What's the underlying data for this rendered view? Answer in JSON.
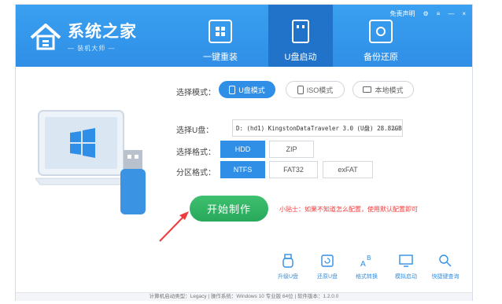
{
  "header": {
    "logo_title": "系统之家",
    "logo_sub": "— 装机大师 —",
    "nav": [
      {
        "label": "一键重装"
      },
      {
        "label": "U盘启动"
      },
      {
        "label": "备份还原"
      }
    ],
    "top_right": {
      "disclaimer": "免责声明",
      "minimize": "—",
      "close": "×"
    }
  },
  "main": {
    "mode_label": "选择模式：",
    "modes": [
      {
        "label": "U盘模式",
        "selected": true
      },
      {
        "label": "ISO模式",
        "selected": false
      },
      {
        "label": "本地模式",
        "selected": false
      }
    ],
    "usb_label": "选择U盘：",
    "usb_value": "D: (hd1) KingstonDataTraveler 3.0 (U盘) 28.82GB",
    "format_label": "选择格式：",
    "formats": [
      {
        "label": "HDD",
        "selected": true
      },
      {
        "label": "ZIP",
        "selected": false
      }
    ],
    "partition_label": "分区格式：",
    "partitions": [
      {
        "label": "NTFS",
        "selected": true
      },
      {
        "label": "FAT32",
        "selected": false
      },
      {
        "label": "exFAT",
        "selected": false
      }
    ],
    "start_button": "开始制作",
    "tip": "小贴士：如果不知道怎么配置，使用默认配置即可"
  },
  "tools": [
    {
      "label": "升级U盘",
      "icon": "usb-upgrade-icon"
    },
    {
      "label": "还原U盘",
      "icon": "usb-restore-icon"
    },
    {
      "label": "格式转换",
      "icon": "format-convert-icon"
    },
    {
      "label": "模拟启动",
      "icon": "monitor-icon"
    },
    {
      "label": "快捷键查询",
      "icon": "key-search-icon"
    }
  ],
  "status_bar": "计算机启动类型：Legacy | 操作系统：Windows 10 专业版 64位 | 软件版本：1.2.0.0",
  "colors": {
    "accent": "#2f8fe6",
    "active_nav": "#2073c8",
    "start": "#2eb065",
    "tip": "#ef3b3b"
  }
}
